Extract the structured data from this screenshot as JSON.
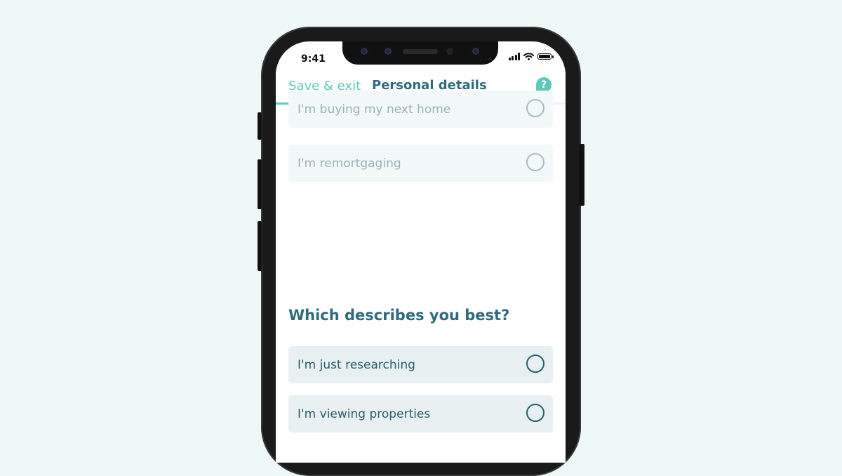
{
  "status_bar": {
    "time": "9:41"
  },
  "header": {
    "save_exit_label": "Save & exit",
    "title": "Personal details",
    "help_label": "?"
  },
  "progress": {
    "fraction": 0.053
  },
  "previous_options": [
    {
      "label": "I'm buying my next home"
    },
    {
      "label": "I'm remortgaging"
    }
  ],
  "question": {
    "text": "Which describes you best?",
    "options": [
      {
        "label": "I'm just researching"
      },
      {
        "label": "I'm viewing properties"
      }
    ]
  },
  "colors": {
    "accent": "#5cc9bb",
    "title": "#2f6b7c",
    "background": "#eef9f7"
  }
}
